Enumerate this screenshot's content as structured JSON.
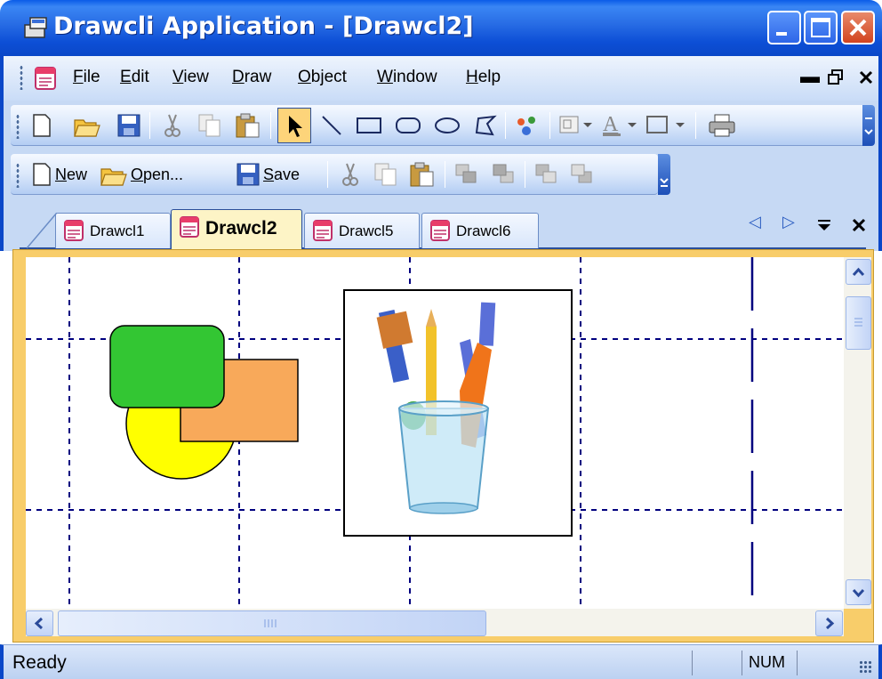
{
  "window": {
    "title": "Drawcli Application - [Drawcl2]",
    "icons": [
      "app-icon",
      "minimize-icon",
      "maximize-icon",
      "close-icon"
    ]
  },
  "menubar": {
    "items": [
      "File",
      "Edit",
      "View",
      "Draw",
      "Object",
      "Window",
      "Help"
    ],
    "mnemonics": [
      "F",
      "E",
      "V",
      "D",
      "O",
      "W",
      "H"
    ],
    "mdi_controls": [
      "minimize-child-icon",
      "restore-child-icon",
      "close-child-icon"
    ]
  },
  "toolbar_draw": {
    "icons": [
      "new-icon",
      "open-icon",
      "save-icon",
      "cut-icon",
      "copy-icon",
      "paste-icon",
      "select-arrow-icon",
      "line-icon",
      "rectangle-icon",
      "rounded-rectangle-icon",
      "ellipse-icon",
      "polygon-icon",
      "ole-object-icon",
      "fill-color-icon",
      "line-color-icon",
      "border-icon",
      "print-icon"
    ],
    "selected_tool": "select-arrow-icon"
  },
  "toolbar_standard": {
    "new_label": "New",
    "open_label": "Open...",
    "save_label": "Save",
    "icons": [
      "new-icon",
      "open-icon",
      "save-icon",
      "cut-icon",
      "copy-icon",
      "paste-icon",
      "bring-to-front-icon",
      "send-to-back-icon",
      "move-forward-icon",
      "move-back-icon"
    ]
  },
  "tabs": [
    {
      "label": "Drawcl1",
      "active": false
    },
    {
      "label": "Drawcl2",
      "active": true
    },
    {
      "label": "Drawcl5",
      "active": false
    },
    {
      "label": "Drawcl6",
      "active": false
    }
  ],
  "tab_nav_icons": [
    "scroll-left-icon",
    "scroll-right-icon",
    "tab-list-icon",
    "close-tab-icon"
  ],
  "canvas": {
    "shapes": [
      {
        "type": "ellipse",
        "fill": "#ffff00"
      },
      {
        "type": "rectangle",
        "fill": "#f8a95a"
      },
      {
        "type": "rounded-rectangle",
        "fill": "#33c633"
      },
      {
        "type": "ole-picture",
        "content": "pencil-cup-icon"
      }
    ],
    "grid_line_color": "#00007f"
  },
  "status": {
    "text": "Ready",
    "num": "NUM"
  },
  "colors": {
    "titlebar": "#0a5ce8",
    "toolbar": "#c6d9f4",
    "active_tab": "#fdf4c6",
    "frame": "#f8cd6a",
    "close_button": "#d2441f"
  }
}
